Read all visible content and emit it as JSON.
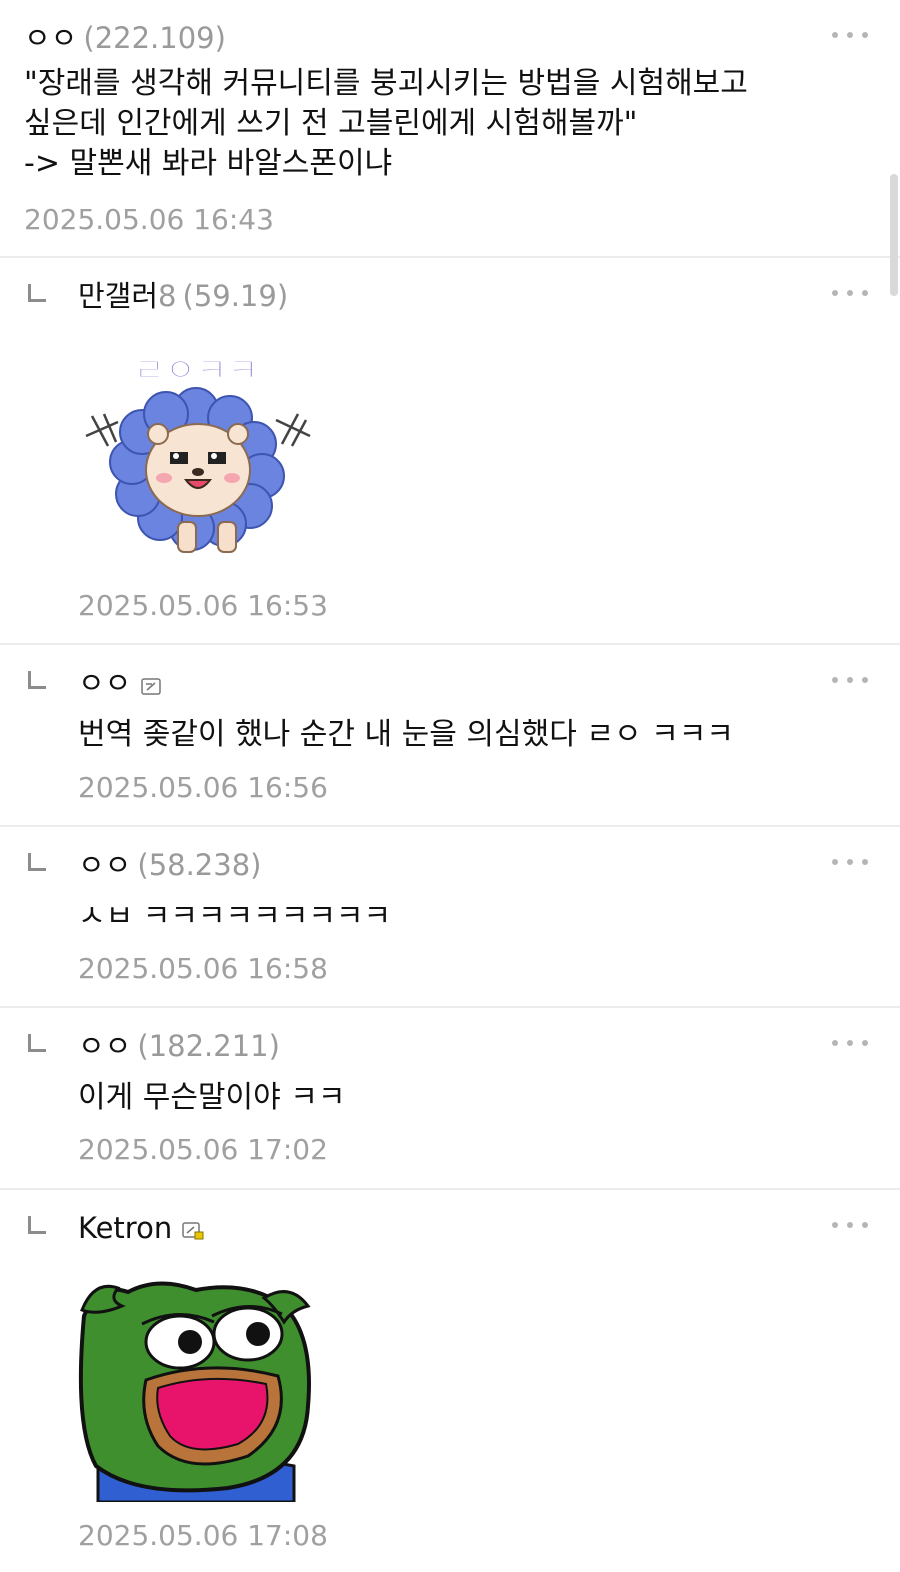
{
  "post_comment": {
    "author": "ㅇㅇ",
    "ip": "(222.109)",
    "text": "\"장래를 생각해 커뮤니티를 붕괴시키는 방법을 시험해보고\n싶은데 인간에게 쓰기 전 고블린에게 시험해볼까\"\n-> 말뽄새 봐라 바알스폰이냐",
    "timestamp": "2025.05.06 16:43"
  },
  "replies": [
    {
      "author": "만갤러",
      "author_num": "8",
      "ip": "(59.19)",
      "sticker_name": "lion-sticker",
      "sticker_text": "ㄹㅇㅋㅋ",
      "timestamp": "2025.05.06 16:53"
    },
    {
      "author": "ㅇㅇ",
      "badge": "fixed-nick-badge",
      "text": "번역 좆같이 했나 순간 내 눈을 의심했다 ㄹㅇ ㅋㅋㅋ",
      "timestamp": "2025.05.06 16:56"
    },
    {
      "author": "ㅇㅇ",
      "ip": "(58.238)",
      "text": "ㅅㅂ ㅋㅋㅋㅋㅋㅋㅋㅋㅋ",
      "timestamp": "2025.05.06 16:58"
    },
    {
      "author": "ㅇㅇ",
      "ip": "(182.211)",
      "text": "이게 무슨말이야 ㅋㅋ",
      "timestamp": "2025.05.06 17:02"
    },
    {
      "author": "Ketron",
      "badge": "semi-fixed-nick-badge",
      "sticker_name": "pepe-sticker",
      "timestamp": "2025.05.06 17:08"
    }
  ],
  "colors": {
    "text": "#111111",
    "meta": "#9a9a9a",
    "divider": "#ececec",
    "badge_gold": "#e8c600",
    "pepe_green": "#3f8f2f",
    "pepe_mouth": "#e8146c",
    "lion_petals": "#6a84e0"
  }
}
